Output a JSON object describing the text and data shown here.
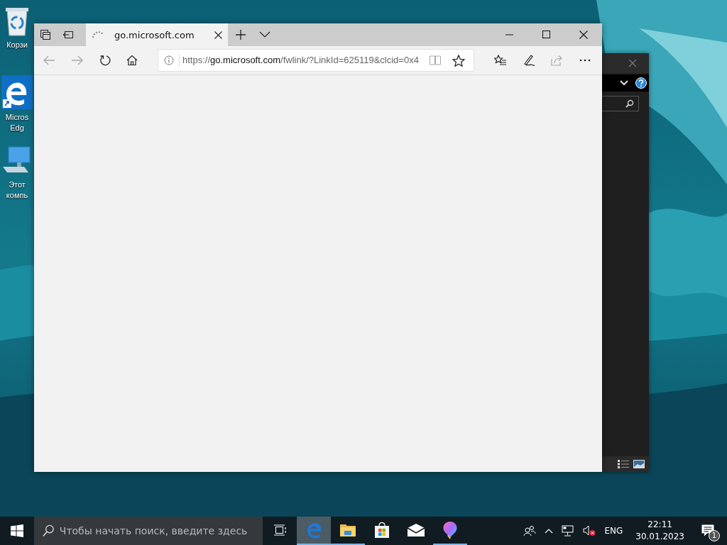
{
  "desktop_icons": [
    {
      "kind": "recycle-bin",
      "lines": [
        "Корзи"
      ]
    },
    {
      "kind": "edge",
      "lines": [
        "Micros",
        "Edg"
      ]
    },
    {
      "kind": "computer",
      "lines": [
        "Этот",
        "компь"
      ]
    }
  ],
  "browser": {
    "tab": {
      "title": "go.microsoft.com",
      "selected": true
    },
    "nav": [
      {
        "kind": "back",
        "disabled": true
      },
      {
        "kind": "forward",
        "disabled": true
      },
      {
        "kind": "refresh",
        "disabled": false
      },
      {
        "kind": "home",
        "disabled": false
      }
    ],
    "address": {
      "scheme": "https://",
      "host": "go.microsoft.com",
      "path": "/fwlink/?LinkId=625119&clcid=0x4"
    },
    "address_tools": [
      {
        "kind": "reading-view",
        "disabled": true
      },
      {
        "kind": "favorite",
        "disabled": false
      }
    ],
    "tools": [
      {
        "kind": "favorites-list",
        "disabled": false
      },
      {
        "kind": "notes",
        "disabled": false
      },
      {
        "kind": "share",
        "disabled": true
      },
      {
        "kind": "more",
        "disabled": false
      }
    ]
  },
  "taskbar": {
    "search": {
      "placeholder": "Чтобы начать поиск, введите здесь"
    },
    "apps": [
      {
        "kind": "task-view",
        "running": false,
        "selected": false
      },
      {
        "kind": "edge",
        "running": true,
        "selected": true
      },
      {
        "kind": "explorer",
        "running": true,
        "selected": false
      },
      {
        "kind": "store",
        "running": false,
        "selected": false
      },
      {
        "kind": "mail",
        "running": false,
        "selected": false
      },
      {
        "kind": "paint",
        "running": true,
        "selected": false
      }
    ],
    "language": "ENG",
    "time": "22:11",
    "date": "30.01.2023",
    "notification_count": "1"
  }
}
